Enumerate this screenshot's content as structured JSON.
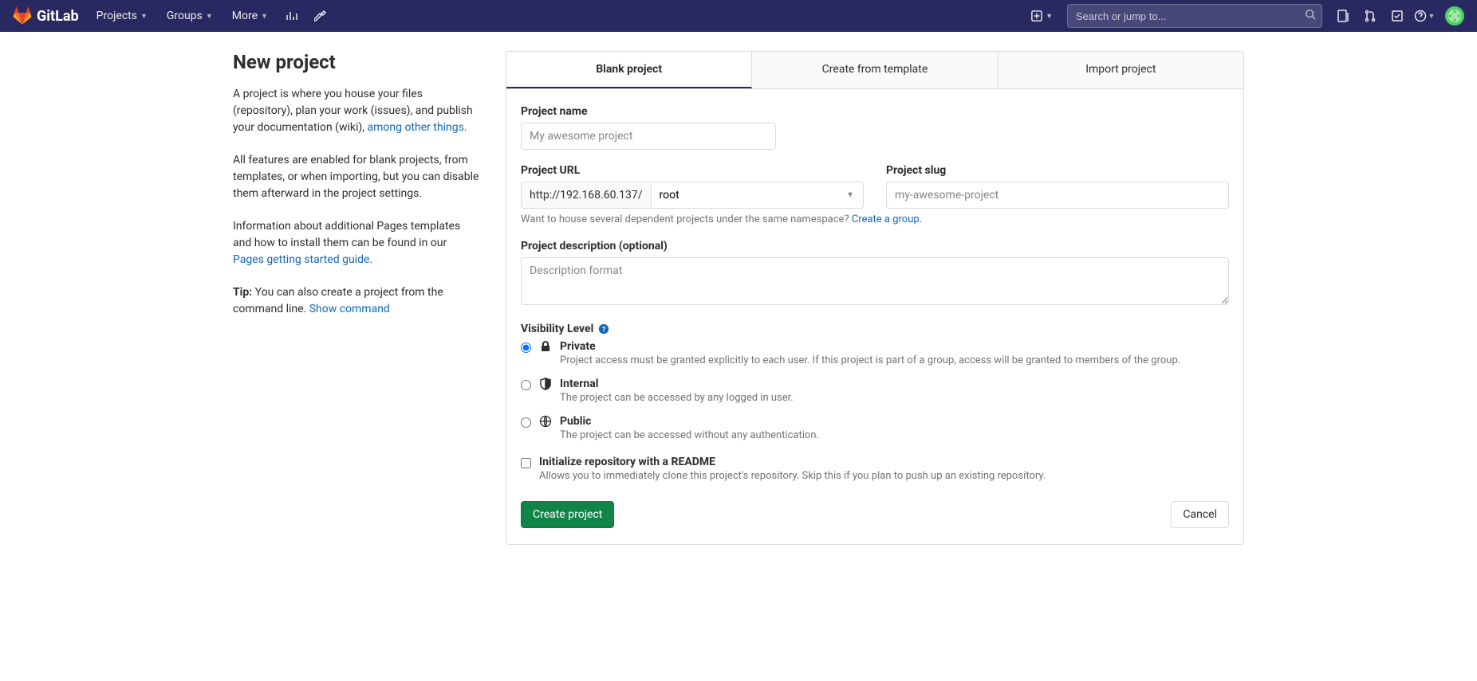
{
  "navbar": {
    "brand": "GitLab",
    "menus": {
      "projects": "Projects",
      "groups": "Groups",
      "more": "More"
    },
    "search_placeholder": "Search or jump to..."
  },
  "sidebar": {
    "heading": "New project",
    "p1_a": "A project is where you house your files (repository), plan your work (issues), and publish your documentation (wiki), ",
    "p1_link": "among other things",
    "p1_b": ".",
    "p2": "All features are enabled for blank projects, from templates, or when importing, but you can disable them afterward in the project settings.",
    "p3_a": "Information about additional Pages templates and how to install them can be found in our ",
    "p3_link": "Pages getting started guide",
    "p3_b": ".",
    "tip_label": "Tip:",
    "tip_text": " You can also create a project from the command line. ",
    "tip_link": "Show command"
  },
  "tabs": {
    "blank": "Blank project",
    "template": "Create from template",
    "import": "Import project"
  },
  "form": {
    "project_name_label": "Project name",
    "project_name_placeholder": "My awesome project",
    "project_url_label": "Project URL",
    "project_url_base": "http://192.168.60.137/",
    "namespace_selected": "root",
    "project_slug_label": "Project slug",
    "project_slug_placeholder": "my-awesome-project",
    "group_hint_a": "Want to house several dependent projects under the same namespace? ",
    "group_hint_link": "Create a group.",
    "description_label": "Project description (optional)",
    "description_placeholder": "Description format",
    "visibility_label": "Visibility Level",
    "visibility": {
      "private": {
        "title": "Private",
        "desc": "Project access must be granted explicitly to each user. If this project is part of a group, access will be granted to members of the group."
      },
      "internal": {
        "title": "Internal",
        "desc": "The project can be accessed by any logged in user."
      },
      "public": {
        "title": "Public",
        "desc": "The project can be accessed without any authentication."
      }
    },
    "readme_title": "Initialize repository with a README",
    "readme_desc": "Allows you to immediately clone this project's repository. Skip this if you plan to push up an existing repository.",
    "submit": "Create project",
    "cancel": "Cancel"
  }
}
